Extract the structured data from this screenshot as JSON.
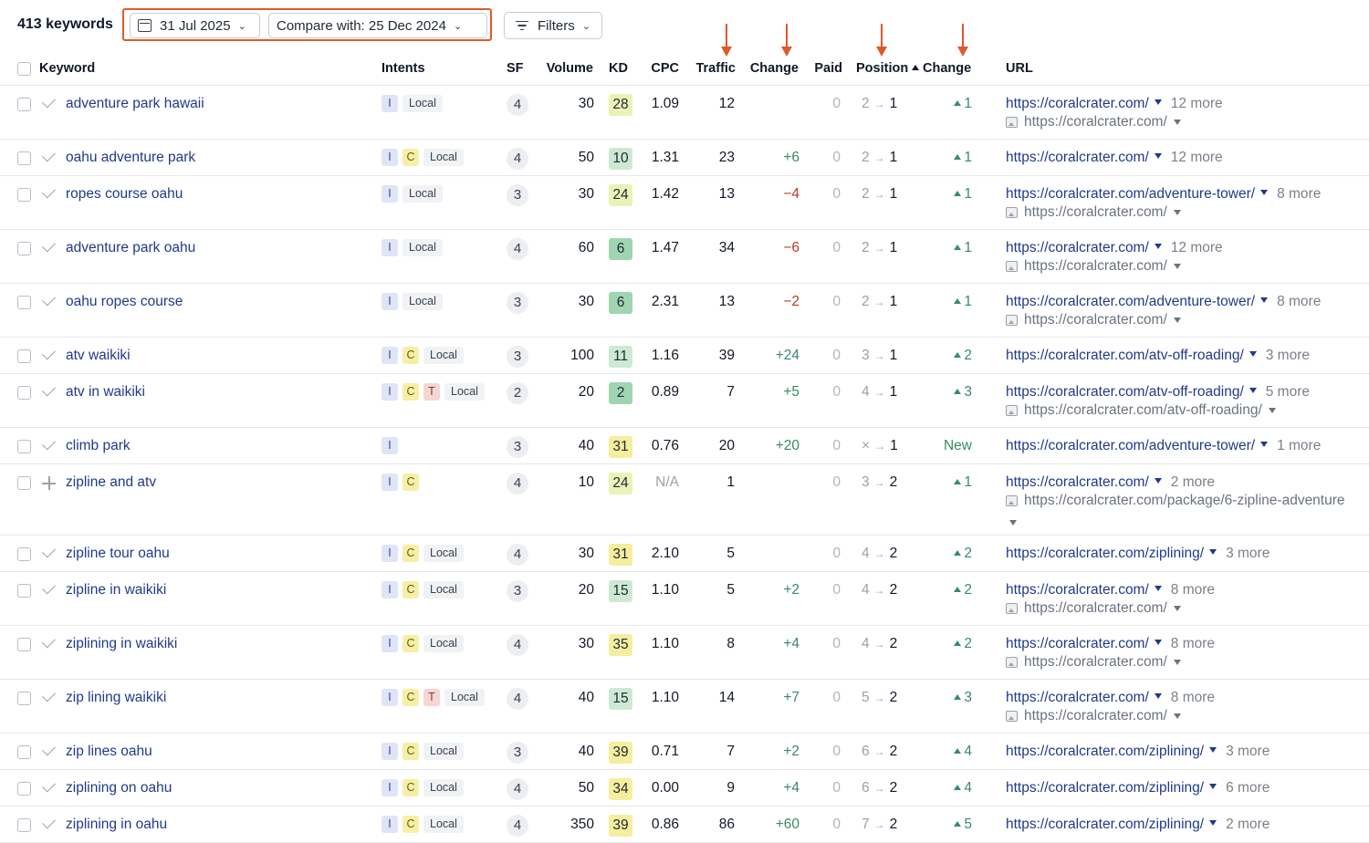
{
  "toolbar": {
    "keyword_count": "413 keywords",
    "date_label": "31 Jul 2025",
    "compare_label": "Compare with: 25 Dec 2024",
    "filters_label": "Filters"
  },
  "colors": {
    "highlight": "#e0592a",
    "link": "#1f3a8a",
    "positive": "#3a8a64",
    "negative": "#c0392b"
  },
  "columns": {
    "keyword": "Keyword",
    "intents": "Intents",
    "sf": "SF",
    "volume": "Volume",
    "kd": "KD",
    "cpc": "CPC",
    "traffic": "Traffic",
    "traffic_change": "Change",
    "paid": "Paid",
    "position": "Position",
    "position_change": "Change",
    "url": "URL"
  },
  "rows": [
    {
      "keyword": "adventure park hawaii",
      "mark": "check",
      "intents": [
        "I"
      ],
      "local": "Local",
      "sf": "4",
      "volume": "30",
      "kd": "28",
      "kd_color": "#eaf2b6",
      "cpc": "1.09",
      "traffic": "12",
      "tchange": "",
      "paid": "0",
      "pos_from": "2",
      "pos_to": "1",
      "pchange": "1",
      "pchange_type": "up",
      "url": "https://coralcrater.com/",
      "more": "12 more",
      "sub_url": "https://coralcrater.com/",
      "sub_wrap": false
    },
    {
      "keyword": "oahu adventure park",
      "mark": "check",
      "intents": [
        "I",
        "C"
      ],
      "local": "Local",
      "sf": "4",
      "volume": "50",
      "kd": "10",
      "kd_color": "#cde9d3",
      "cpc": "1.31",
      "traffic": "23",
      "tchange": "+6",
      "paid": "0",
      "pos_from": "2",
      "pos_to": "1",
      "pchange": "1",
      "pchange_type": "up",
      "url": "https://coralcrater.com/",
      "more": "12 more",
      "sub_url": "",
      "sub_wrap": false
    },
    {
      "keyword": "ropes course oahu",
      "mark": "check",
      "intents": [
        "I"
      ],
      "local": "Local",
      "sf": "3",
      "volume": "30",
      "kd": "24",
      "kd_color": "#eaf2b6",
      "cpc": "1.42",
      "traffic": "13",
      "tchange": "−4",
      "paid": "0",
      "pos_from": "2",
      "pos_to": "1",
      "pchange": "1",
      "pchange_type": "up",
      "url": "https://coralcrater.com/adventure-tower/",
      "more": "8 more",
      "sub_url": "https://coralcrater.com/",
      "sub_wrap": false
    },
    {
      "keyword": "adventure park oahu",
      "mark": "check",
      "intents": [
        "I"
      ],
      "local": "Local",
      "sf": "4",
      "volume": "60",
      "kd": "6",
      "kd_color": "#9fd5b1",
      "cpc": "1.47",
      "traffic": "34",
      "tchange": "−6",
      "paid": "0",
      "pos_from": "2",
      "pos_to": "1",
      "pchange": "1",
      "pchange_type": "up",
      "url": "https://coralcrater.com/",
      "more": "12 more",
      "sub_url": "https://coralcrater.com/",
      "sub_wrap": false
    },
    {
      "keyword": "oahu ropes course",
      "mark": "check",
      "intents": [
        "I"
      ],
      "local": "Local",
      "sf": "3",
      "volume": "30",
      "kd": "6",
      "kd_color": "#9fd5b1",
      "cpc": "2.31",
      "traffic": "13",
      "tchange": "−2",
      "paid": "0",
      "pos_from": "2",
      "pos_to": "1",
      "pchange": "1",
      "pchange_type": "up",
      "url": "https://coralcrater.com/adventure-tower/",
      "more": "8 more",
      "sub_url": "https://coralcrater.com/",
      "sub_wrap": false
    },
    {
      "keyword": "atv waikiki",
      "mark": "check",
      "intents": [
        "I",
        "C"
      ],
      "local": "Local",
      "sf": "3",
      "volume": "100",
      "kd": "11",
      "kd_color": "#cde9d3",
      "cpc": "1.16",
      "traffic": "39",
      "tchange": "+24",
      "paid": "0",
      "pos_from": "3",
      "pos_to": "1",
      "pchange": "2",
      "pchange_type": "up",
      "url": "https://coralcrater.com/atv-off-roading/",
      "more": "3 more",
      "sub_url": "",
      "sub_wrap": false
    },
    {
      "keyword": "atv in waikiki",
      "mark": "check",
      "intents": [
        "I",
        "C",
        "T"
      ],
      "local": "Local",
      "sf": "2",
      "volume": "20",
      "kd": "2",
      "kd_color": "#9fd5b1",
      "cpc": "0.89",
      "traffic": "7",
      "tchange": "+5",
      "paid": "0",
      "pos_from": "4",
      "pos_to": "1",
      "pchange": "3",
      "pchange_type": "up",
      "url": "https://coralcrater.com/atv-off-roading/",
      "more": "5 more",
      "sub_url": "https://coralcrater.com/atv-off-roading/",
      "sub_wrap": false
    },
    {
      "keyword": "climb park",
      "mark": "check",
      "intents": [
        "I"
      ],
      "local": "",
      "sf": "3",
      "volume": "40",
      "kd": "31",
      "kd_color": "#f4ee9e",
      "cpc": "0.76",
      "traffic": "20",
      "tchange": "+20",
      "paid": "0",
      "pos_from": "×",
      "pos_to": "1",
      "pchange": "New",
      "pchange_type": "new",
      "url": "https://coralcrater.com/adventure-tower/",
      "more": "1 more",
      "sub_url": "",
      "sub_wrap": false
    },
    {
      "keyword": "zipline and atv",
      "mark": "plus",
      "intents": [
        "I",
        "C"
      ],
      "local": "",
      "sf": "4",
      "volume": "10",
      "kd": "24",
      "kd_color": "#eaf2b6",
      "cpc": "N/A",
      "traffic": "1",
      "tchange": "",
      "paid": "0",
      "pos_from": "3",
      "pos_to": "2",
      "pchange": "1",
      "pchange_type": "up",
      "url": "https://coralcrater.com/",
      "more": "2 more",
      "sub_url": "https://coralcrater.com/package/6-zipline-adventure",
      "sub_wrap": true
    },
    {
      "keyword": "zipline tour oahu",
      "mark": "check",
      "intents": [
        "I",
        "C"
      ],
      "local": "Local",
      "sf": "4",
      "volume": "30",
      "kd": "31",
      "kd_color": "#f4ee9e",
      "cpc": "2.10",
      "traffic": "5",
      "tchange": "",
      "paid": "0",
      "pos_from": "4",
      "pos_to": "2",
      "pchange": "2",
      "pchange_type": "up",
      "url": "https://coralcrater.com/ziplining/",
      "more": "3 more",
      "sub_url": "",
      "sub_wrap": false
    },
    {
      "keyword": "zipline in waikiki",
      "mark": "check",
      "intents": [
        "I",
        "C"
      ],
      "local": "Local",
      "sf": "3",
      "volume": "20",
      "kd": "15",
      "kd_color": "#cde9d3",
      "cpc": "1.10",
      "traffic": "5",
      "tchange": "+2",
      "paid": "0",
      "pos_from": "4",
      "pos_to": "2",
      "pchange": "2",
      "pchange_type": "up",
      "url": "https://coralcrater.com/",
      "more": "8 more",
      "sub_url": "https://coralcrater.com/",
      "sub_wrap": false
    },
    {
      "keyword": "ziplining in waikiki",
      "mark": "check",
      "intents": [
        "I",
        "C"
      ],
      "local": "Local",
      "sf": "4",
      "volume": "30",
      "kd": "35",
      "kd_color": "#f4ee9e",
      "cpc": "1.10",
      "traffic": "8",
      "tchange": "+4",
      "paid": "0",
      "pos_from": "4",
      "pos_to": "2",
      "pchange": "2",
      "pchange_type": "up",
      "url": "https://coralcrater.com/",
      "more": "8 more",
      "sub_url": "https://coralcrater.com/",
      "sub_wrap": false
    },
    {
      "keyword": "zip lining waikiki",
      "mark": "check",
      "intents": [
        "I",
        "C",
        "T"
      ],
      "local": "Local",
      "sf": "4",
      "volume": "40",
      "kd": "15",
      "kd_color": "#cde9d3",
      "cpc": "1.10",
      "traffic": "14",
      "tchange": "+7",
      "paid": "0",
      "pos_from": "5",
      "pos_to": "2",
      "pchange": "3",
      "pchange_type": "up",
      "url": "https://coralcrater.com/",
      "more": "8 more",
      "sub_url": "https://coralcrater.com/",
      "sub_wrap": false
    },
    {
      "keyword": "zip lines oahu",
      "mark": "check",
      "intents": [
        "I",
        "C"
      ],
      "local": "Local",
      "sf": "3",
      "volume": "40",
      "kd": "39",
      "kd_color": "#f4ee9e",
      "cpc": "0.71",
      "traffic": "7",
      "tchange": "+2",
      "paid": "0",
      "pos_from": "6",
      "pos_to": "2",
      "pchange": "4",
      "pchange_type": "up",
      "url": "https://coralcrater.com/ziplining/",
      "more": "3 more",
      "sub_url": "",
      "sub_wrap": false
    },
    {
      "keyword": "ziplining on oahu",
      "mark": "check",
      "intents": [
        "I",
        "C"
      ],
      "local": "Local",
      "sf": "4",
      "volume": "50",
      "kd": "34",
      "kd_color": "#f4ee9e",
      "cpc": "0.00",
      "traffic": "9",
      "tchange": "+4",
      "paid": "0",
      "pos_from": "6",
      "pos_to": "2",
      "pchange": "4",
      "pchange_type": "up",
      "url": "https://coralcrater.com/ziplining/",
      "more": "6 more",
      "sub_url": "",
      "sub_wrap": false
    },
    {
      "keyword": "ziplining in oahu",
      "mark": "check",
      "intents": [
        "I",
        "C"
      ],
      "local": "Local",
      "sf": "4",
      "volume": "350",
      "kd": "39",
      "kd_color": "#f4ee9e",
      "cpc": "0.86",
      "traffic": "86",
      "tchange": "+60",
      "paid": "0",
      "pos_from": "7",
      "pos_to": "2",
      "pchange": "5",
      "pchange_type": "up",
      "url": "https://coralcrater.com/ziplining/",
      "more": "2 more",
      "sub_url": "",
      "sub_wrap": false
    }
  ]
}
